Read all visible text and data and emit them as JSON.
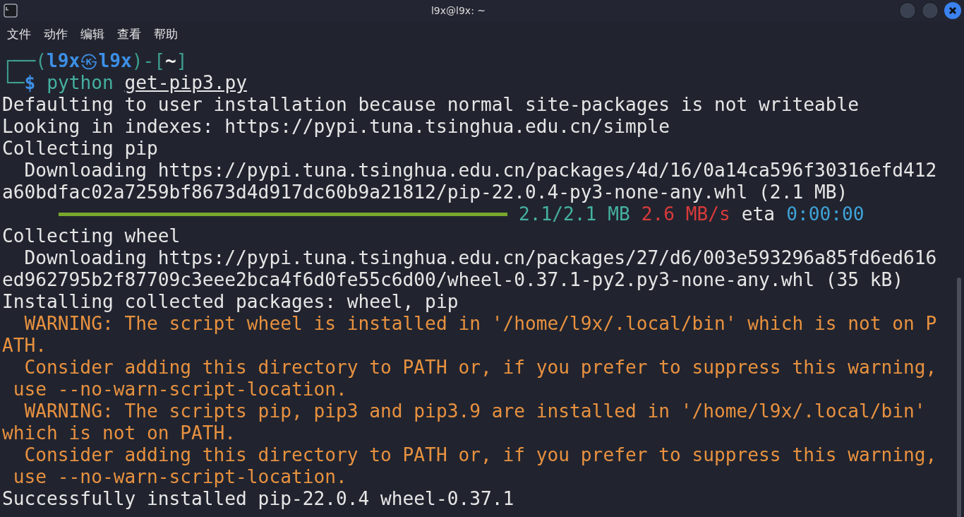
{
  "window": {
    "title": "l9x@l9x: ~"
  },
  "menu": [
    "文件",
    "动作",
    "编辑",
    "查看",
    "帮助"
  ],
  "prompt": {
    "open": "┌──(",
    "user": "l9x",
    "symbol": "㉿",
    "host": "l9x",
    "mid": ")-[",
    "dir": "~",
    "close": "]",
    "corner": "└─",
    "sign": "$",
    "command": "python",
    "argument": "get-pip3.py"
  },
  "lines": [
    {
      "kind": "normal",
      "text": "Defaulting to user installation because normal site-packages is not writeable"
    },
    {
      "kind": "normal",
      "text": "Looking in indexes: https://pypi.tuna.tsinghua.edu.cn/simple"
    },
    {
      "kind": "normal",
      "text": "Collecting pip"
    },
    {
      "kind": "normal",
      "text": "  Downloading https://pypi.tuna.tsinghua.edu.cn/packages/4d/16/0a14ca596f30316efd412"
    },
    {
      "kind": "normal",
      "text": "a60bdfac02a7259bf8673d4d917dc60b9a21812/pip-22.0.4-py3-none-any.whl (2.1 MB)"
    },
    {
      "kind": "progress",
      "level": 1,
      "size": "2.1/2.1 MB",
      "speed": "2.6 MB/s",
      "eta_label": "eta",
      "eta": "0:00:00"
    },
    {
      "kind": "normal",
      "text": "Collecting wheel"
    },
    {
      "kind": "normal",
      "text": "  Downloading https://pypi.tuna.tsinghua.edu.cn/packages/27/d6/003e593296a85fd6ed616"
    },
    {
      "kind": "normal",
      "text": "ed962795b2f87709c3eee2bca4f6d0fe55c6d00/wheel-0.37.1-py2.py3-none-any.whl (35 kB)"
    },
    {
      "kind": "normal",
      "text": "Installing collected packages: wheel, pip"
    },
    {
      "kind": "warning",
      "text": "  WARNING: The script wheel is installed in '/home/l9x/.local/bin' which is not on P"
    },
    {
      "kind": "warning",
      "text": "ATH."
    },
    {
      "kind": "warning",
      "text": "  Consider adding this directory to PATH or, if you prefer to suppress this warning,"
    },
    {
      "kind": "warning",
      "text": " use --no-warn-script-location."
    },
    {
      "kind": "warning",
      "text": "  WARNING: The scripts pip, pip3 and pip3.9 are installed in '/home/l9x/.local/bin'"
    },
    {
      "kind": "warning",
      "text": "which is not on PATH."
    },
    {
      "kind": "warning",
      "text": "  Consider adding this directory to PATH or, if you prefer to suppress this warning,"
    },
    {
      "kind": "warning",
      "text": " use --no-warn-script-location."
    },
    {
      "kind": "normal",
      "text": "Successfully installed pip-22.0.4 wheel-0.37.1"
    }
  ]
}
